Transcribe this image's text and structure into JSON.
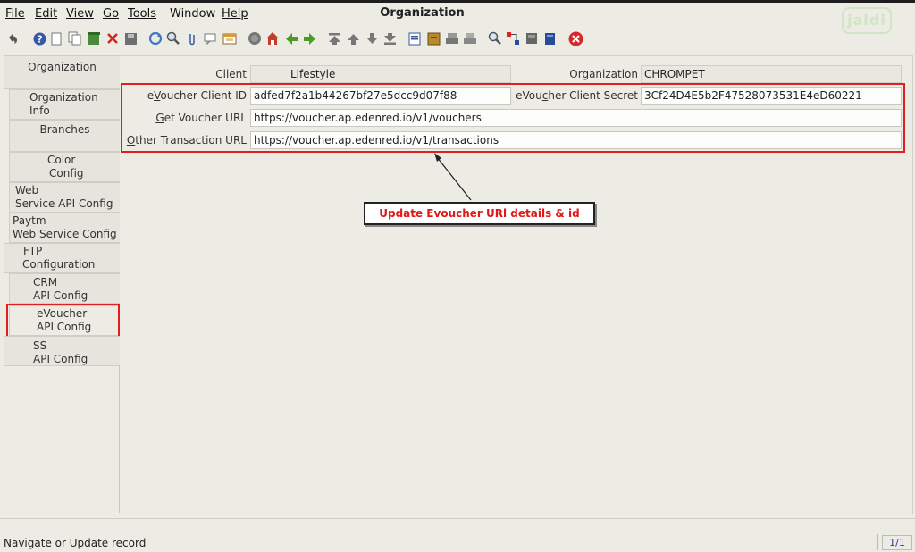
{
  "app": {
    "title": "Organization",
    "logo_text": "jaldi"
  },
  "menu": [
    {
      "label": "File"
    },
    {
      "label": "Edit"
    },
    {
      "label": "View"
    },
    {
      "label": "Go"
    },
    {
      "label": "Tools"
    },
    {
      "label": "Window"
    },
    {
      "label": "Help"
    }
  ],
  "toolbar": {
    "icons": [
      "undo-icon",
      "help-icon",
      "new-icon",
      "copy-icon",
      "delete-icon",
      "delete-cross-icon",
      "save-icon",
      "refresh-icon",
      "find-icon",
      "attachment-icon",
      "chat-icon",
      "history-icon",
      "home-icon",
      "back-icon",
      "forward-icon",
      "first-icon",
      "previous-icon",
      "next-icon",
      "last-icon",
      "report-icon",
      "archive-icon",
      "print-icon",
      "print-preview-icon",
      "zoom-icon",
      "workflow-icon",
      "product-icon",
      "request-icon",
      "exit-icon"
    ]
  },
  "tabs": {
    "organization": "Organization",
    "org_info_1": "Organization",
    "org_info_2": "Info",
    "branches": "Branches",
    "color_1": "Color",
    "color_2": "Config",
    "web_1": "Web",
    "web_2": "Service API Config",
    "paytm_1": "Paytm",
    "paytm_2": "Web Service Config",
    "ftp_1": "FTP",
    "ftp_2": "Configuration",
    "crm_1": "CRM",
    "crm_2": "API Config",
    "evoucher_1": "eVoucher",
    "evoucher_2": "API Config",
    "ss_1": "SS",
    "ss_2": "API Config"
  },
  "form": {
    "client_label": "Client",
    "client_value": "Lifestyle",
    "organization_label": "Organization",
    "organization_value": "CHROMPET",
    "client_id_label_first": "e",
    "client_id_label_underlined": "V",
    "client_id_label_rest": "oucher Client ID",
    "client_id_value": "adfed7f2a1b44267bf27e5dcc9d07f88",
    "client_secret_label_pre": "eVou",
    "client_secret_label_underlined": "c",
    "client_secret_label_rest": "her Client Secret",
    "client_secret_value": "3Cf24D4E5b2F47528073531E4eD60221",
    "get_voucher_label_underlined": "G",
    "get_voucher_label_rest": "et Voucher URL",
    "get_voucher_value": "https://voucher.ap.edenred.io/v1/vouchers",
    "other_txn_label_underlined": "O",
    "other_txn_label_rest": "ther Transaction URL",
    "other_txn_value": "https://voucher.ap.edenred.io/v1/transactions"
  },
  "annotation": {
    "callout": "Update Evoucher URl details & id"
  },
  "status": {
    "message": "Navigate or Update record",
    "page": "1/1"
  },
  "colors": {
    "highlight": "#e02020",
    "callout_text": "#e01818",
    "page_indicator": "#2a3aa0"
  }
}
